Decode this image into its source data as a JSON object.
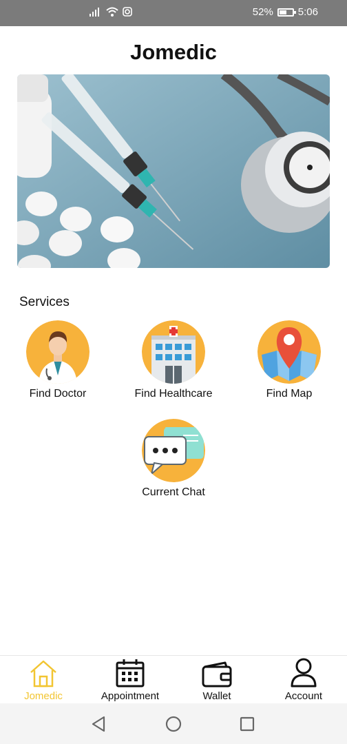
{
  "status_bar": {
    "battery_percent": "52%",
    "time": "5:06"
  },
  "app": {
    "title": "Jomedic"
  },
  "services": {
    "heading": "Services",
    "items": [
      {
        "label": "Find Doctor",
        "icon": "doctor-icon"
      },
      {
        "label": "Find Healthcare",
        "icon": "hospital-icon"
      },
      {
        "label": "Find Map",
        "icon": "map-pin-icon"
      },
      {
        "label": "Current Chat",
        "icon": "chat-icon"
      }
    ]
  },
  "bottom_nav": {
    "items": [
      {
        "label": "Jomedic",
        "icon": "home-icon",
        "active": true
      },
      {
        "label": "Appointment",
        "icon": "calendar-icon",
        "active": false
      },
      {
        "label": "Wallet",
        "icon": "wallet-icon",
        "active": false
      },
      {
        "label": "Account",
        "icon": "user-icon",
        "active": false
      }
    ]
  },
  "colors": {
    "accent": "#f2c531",
    "service_circle": "#f7b23b",
    "status_bar": "#7b7b7b",
    "banner_bg": "#7fa8bb"
  }
}
